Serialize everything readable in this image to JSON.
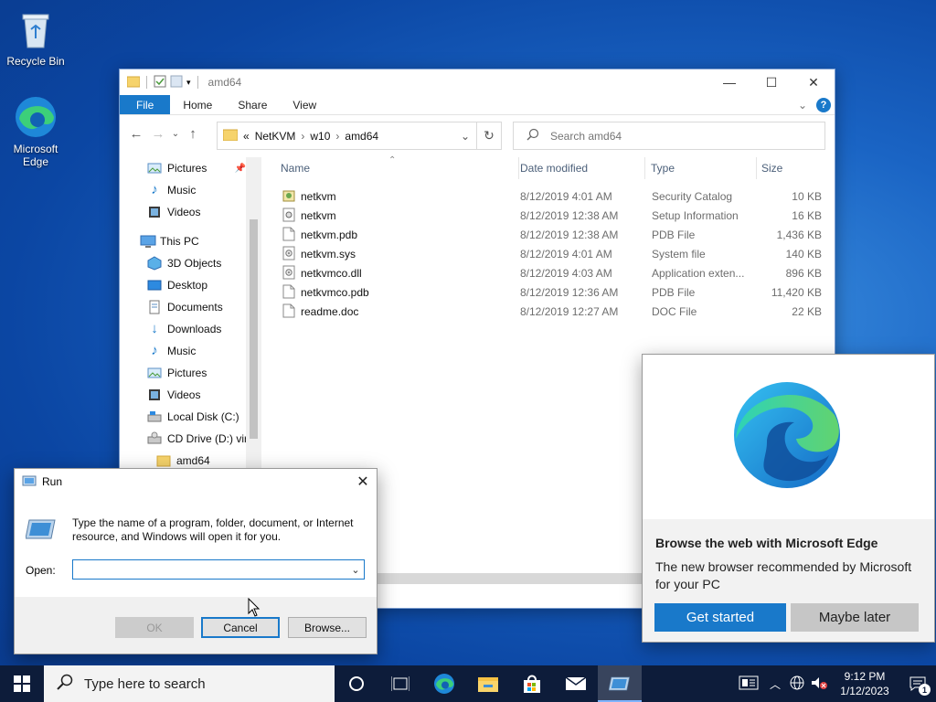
{
  "desktop": {
    "icons": [
      {
        "label": "Recycle Bin"
      },
      {
        "label": "Microsoft Edge"
      }
    ]
  },
  "explorer": {
    "title": "amd64",
    "ribbon_tabs": [
      "File",
      "Home",
      "Share",
      "View"
    ],
    "breadcrumb": [
      "«",
      "NetKVM",
      "w10",
      "amd64"
    ],
    "search_placeholder": "Search amd64",
    "nav_items": [
      {
        "label": "Pictures",
        "icon": "pictures-icon",
        "pinned": true
      },
      {
        "label": "Music",
        "icon": "music-icon"
      },
      {
        "label": "Videos",
        "icon": "videos-icon"
      },
      {
        "label": "This PC",
        "icon": "computer-icon"
      },
      {
        "label": "3D Objects",
        "icon": "3d-objects-icon"
      },
      {
        "label": "Desktop",
        "icon": "desktop-icon"
      },
      {
        "label": "Documents",
        "icon": "documents-icon"
      },
      {
        "label": "Downloads",
        "icon": "downloads-icon"
      },
      {
        "label": "Music",
        "icon": "music-icon"
      },
      {
        "label": "Pictures",
        "icon": "pictures-icon"
      },
      {
        "label": "Videos",
        "icon": "videos-icon"
      },
      {
        "label": "Local Disk (C:)",
        "icon": "drive-icon"
      },
      {
        "label": "CD Drive (D:) virt",
        "icon": "cd-drive-icon"
      },
      {
        "label": "amd64",
        "icon": "folder-icon"
      }
    ],
    "columns": {
      "name": "Name",
      "date": "Date modified",
      "type": "Type",
      "size": "Size"
    },
    "files": [
      {
        "name": "netkvm",
        "date": "8/12/2019 4:01 AM",
        "type": "Security Catalog",
        "size": "10 KB"
      },
      {
        "name": "netkvm",
        "date": "8/12/2019 12:38 AM",
        "type": "Setup Information",
        "size": "16 KB"
      },
      {
        "name": "netkvm.pdb",
        "date": "8/12/2019 12:38 AM",
        "type": "PDB File",
        "size": "1,436 KB"
      },
      {
        "name": "netkvm.sys",
        "date": "8/12/2019 4:01 AM",
        "type": "System file",
        "size": "140 KB"
      },
      {
        "name": "netkvmco.dll",
        "date": "8/12/2019 4:03 AM",
        "type": "Application exten...",
        "size": "896 KB"
      },
      {
        "name": "netkvmco.pdb",
        "date": "8/12/2019 12:36 AM",
        "type": "PDB File",
        "size": "11,420 KB"
      },
      {
        "name": "readme.doc",
        "date": "8/12/2019 12:27 AM",
        "type": "DOC File",
        "size": "22 KB"
      }
    ]
  },
  "run": {
    "title": "Run",
    "description": "Type the name of a program, folder, document, or Internet resource, and Windows will open it for you.",
    "open_label": "Open:",
    "open_value": "",
    "ok": "OK",
    "cancel": "Cancel",
    "browse": "Browse..."
  },
  "edge_promo": {
    "heading": "Browse the web with Microsoft Edge",
    "body": "The new browser recommended by Microsoft for your PC",
    "primary": "Get started",
    "secondary": "Maybe later"
  },
  "taskbar": {
    "search_placeholder": "Type here to search",
    "time": "9:12 PM",
    "date": "1/12/2023",
    "notification_count": "1"
  }
}
